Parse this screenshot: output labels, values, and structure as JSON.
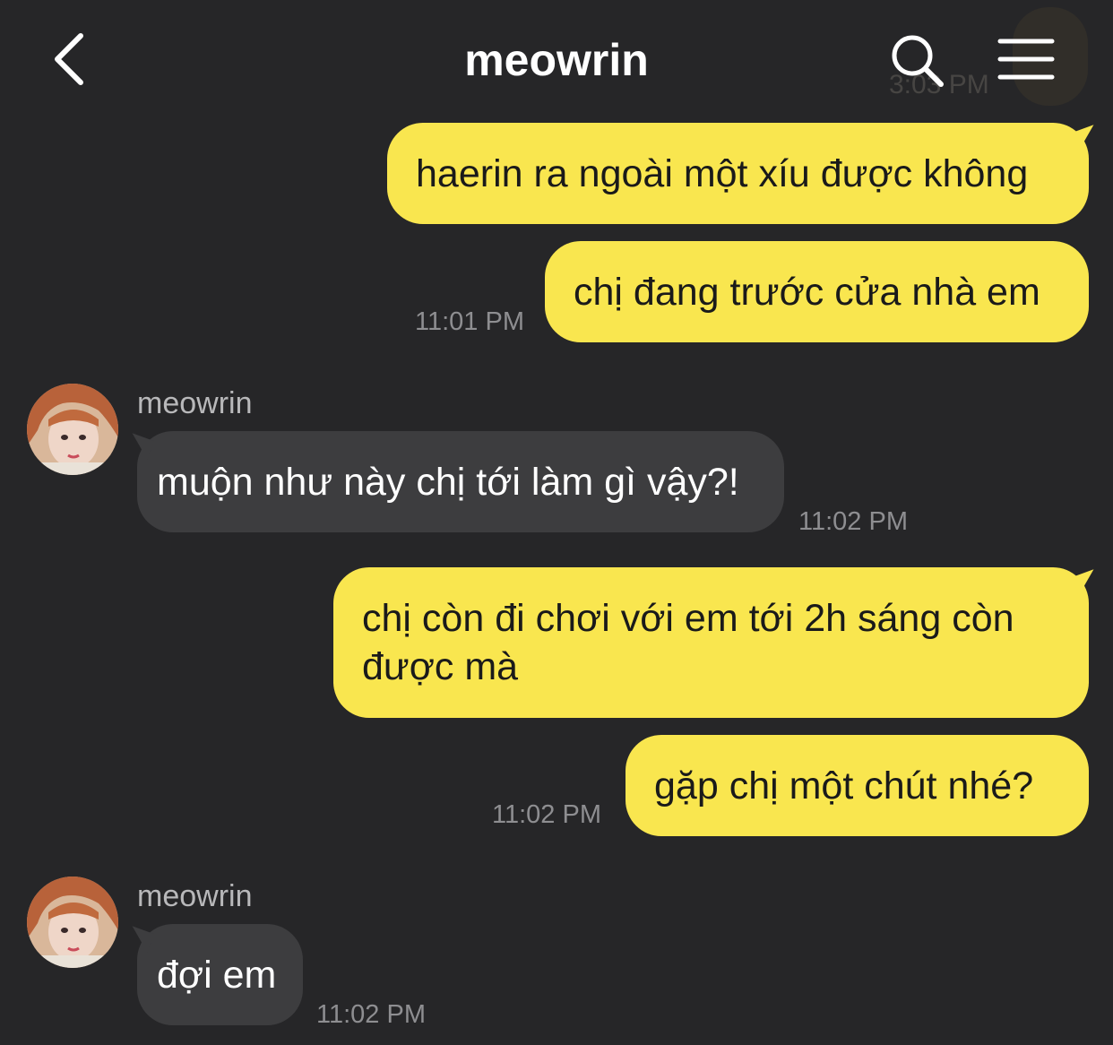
{
  "header": {
    "title": "meowrin",
    "back_icon": "chevron-left-icon",
    "search_icon": "search-icon",
    "menu_icon": "hamburger-menu-icon",
    "faded_time": "3:03 PM"
  },
  "colors": {
    "background": "#262628",
    "my_bubble": "#f9e64f",
    "their_bubble": "#3d3d3f",
    "timestamp": "#8e8e91"
  },
  "messages": [
    {
      "from": "me",
      "text": "haerin ra ngoài một xíu được không"
    },
    {
      "from": "me",
      "text": "chị đang trước cửa nhà em",
      "time": "11:01 PM"
    },
    {
      "from": "them",
      "sender": "meowrin",
      "text": "muộn như này chị tới làm gì vậy?!",
      "time": "11:02 PM"
    },
    {
      "from": "me",
      "text": "chị còn đi chơi với em tới 2h sáng còn được mà"
    },
    {
      "from": "me",
      "text": "gặp chị một chút nhé?",
      "time": "11:02 PM"
    },
    {
      "from": "them",
      "sender": "meowrin",
      "text": "đợi em",
      "time": "11:02 PM"
    }
  ]
}
